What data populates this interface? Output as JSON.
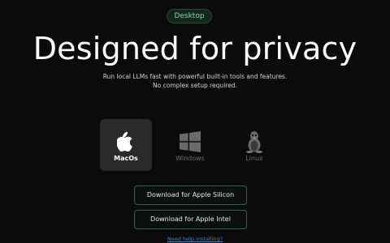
{
  "badge": {
    "label": "Desktop"
  },
  "hero": {
    "title": "Designed for privacy",
    "subtitle_line1": "Run local LLMs fast with powerful built-in tools and features.",
    "subtitle_line2": "No complex setup required."
  },
  "platforms": {
    "selected": "MacOs",
    "items": [
      {
        "label": "MacOs",
        "icon": "apple-icon",
        "active": true
      },
      {
        "label": "Windows",
        "icon": "windows-icon",
        "active": false
      },
      {
        "label": "Linux",
        "icon": "linux-tux-icon",
        "active": false
      }
    ]
  },
  "downloads": {
    "apple_silicon_label": "Download for Apple Silicon",
    "apple_intel_label": "Download for Apple Intel"
  },
  "help": {
    "link_label": "Need help installing?"
  },
  "colors": {
    "background": "#0b0b0b",
    "accent_border": "#1f6b45",
    "badge_text": "#8fd3ad",
    "link": "#3a86d6"
  }
}
